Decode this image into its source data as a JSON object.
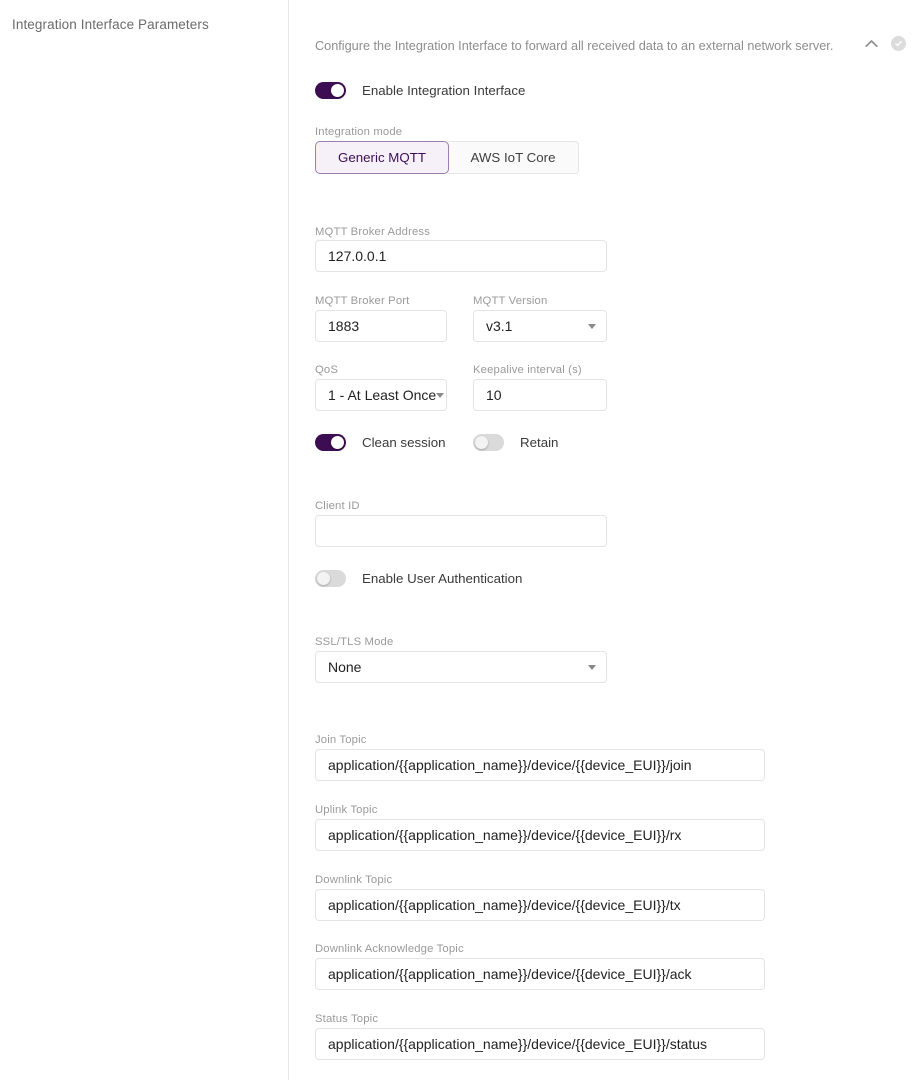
{
  "page": {
    "section_title": "Integration Interface Parameters",
    "description": "Configure the Integration Interface to forward all received data to an external network server.",
    "collapse_icon": "chevron-up-icon",
    "status_icon": "check-circle-icon"
  },
  "enable": {
    "label": "Enable Integration Interface",
    "state": "on"
  },
  "integration_mode": {
    "label": "Integration mode",
    "options": [
      "Generic MQTT",
      "AWS IoT Core"
    ],
    "selected": "Generic MQTT"
  },
  "broker_address": {
    "label": "MQTT Broker Address",
    "value": "127.0.0.1",
    "placeholder": ""
  },
  "broker_port": {
    "label": "MQTT Broker Port",
    "value": "1883",
    "placeholder": ""
  },
  "mqtt_version": {
    "label": "MQTT Version",
    "value": "v3.1"
  },
  "qos": {
    "label": "QoS",
    "value": "1 - At Least Once"
  },
  "keepalive": {
    "label": "Keepalive interval (s)",
    "value": "10",
    "placeholder": ""
  },
  "clean_session": {
    "label": "Clean session",
    "state": "on"
  },
  "retain": {
    "label": "Retain",
    "state": "off"
  },
  "client_id": {
    "label": "Client ID",
    "value": "",
    "placeholder": ""
  },
  "user_auth": {
    "label": "Enable User Authentication",
    "state": "off"
  },
  "ssl_tls_mode": {
    "label": "SSL/TLS Mode",
    "value": "None"
  },
  "topics": [
    {
      "label": "Join Topic",
      "value": "application/{{application_name}}/device/{{device_EUI}}/join"
    },
    {
      "label": "Uplink Topic",
      "value": "application/{{application_name}}/device/{{device_EUI}}/rx"
    },
    {
      "label": "Downlink Topic",
      "value": "application/{{application_name}}/device/{{device_EUI}}/tx"
    },
    {
      "label": "Downlink Acknowledge Topic",
      "value": "application/{{application_name}}/device/{{device_EUI}}/ack"
    },
    {
      "label": "Status Topic",
      "value": "application/{{application_name}}/device/{{device_EUI}}/status"
    }
  ],
  "colors": {
    "accent": "#3c0d53",
    "accent_soft_bg": "#f6f1f9",
    "accent_border": "#9c7fb0",
    "border": "#e4e4e4",
    "label": "#9a9a9a",
    "text": "#222222"
  }
}
